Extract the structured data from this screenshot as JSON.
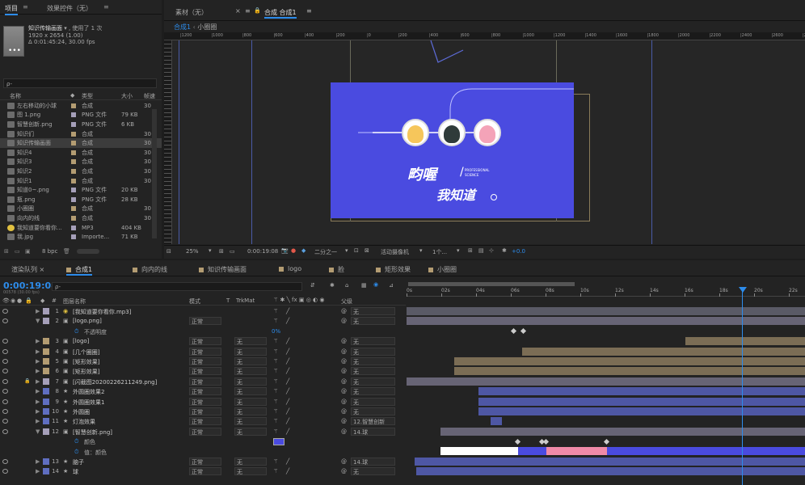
{
  "project": {
    "tab_label": "项目",
    "effects_tab": "效果控件（无）",
    "selected_name": "知识传输画面",
    "used_count": ", 使用了 1 次",
    "resolution": "1920 x 2654 (1.00)",
    "duration": "Δ 0:01:45:24, 30.00 fps",
    "search_placeholder": "ρ-",
    "columns": {
      "name": "名称",
      "type": "类型",
      "size": "大小",
      "fps": "帧速"
    },
    "items": [
      {
        "name": "左右移动的小球",
        "type": "合成",
        "size": "",
        "fps": "30",
        "color": "#b39c72"
      },
      {
        "name": "图 1.png",
        "type": "PNG 文件",
        "size": "79 KB",
        "fps": "",
        "color": "#a59fb9"
      },
      {
        "name": "智慧创新.png",
        "type": "PNG 文件",
        "size": "6 KB",
        "fps": "",
        "color": "#a59fb9"
      },
      {
        "name": "知识们",
        "type": "合成",
        "size": "",
        "fps": "30",
        "color": "#b39c72"
      },
      {
        "name": "知识传输画面",
        "type": "合成",
        "size": "",
        "fps": "30",
        "color": "#b39c72"
      },
      {
        "name": "知识4",
        "type": "合成",
        "size": "",
        "fps": "30",
        "color": "#b39c72"
      },
      {
        "name": "知识3",
        "type": "合成",
        "size": "",
        "fps": "30",
        "color": "#b39c72"
      },
      {
        "name": "知识2",
        "type": "合成",
        "size": "",
        "fps": "30",
        "color": "#b39c72"
      },
      {
        "name": "知识1",
        "type": "合成",
        "size": "",
        "fps": "30",
        "color": "#b39c72"
      },
      {
        "name": "知道0~.png",
        "type": "PNG 文件",
        "size": "20 KB",
        "fps": "",
        "color": "#a59fb9"
      },
      {
        "name": "瓶.png",
        "type": "PNG 文件",
        "size": "28 KB",
        "fps": "",
        "color": "#a59fb9"
      },
      {
        "name": "小圈圈",
        "type": "合成",
        "size": "",
        "fps": "30",
        "color": "#b39c72"
      },
      {
        "name": "向内的线",
        "type": "合成",
        "size": "",
        "fps": "30",
        "color": "#b39c72"
      },
      {
        "name": "我知道要你看你...",
        "type": "MP3",
        "size": "404 KB",
        "fps": "",
        "color": "#a59fb9"
      },
      {
        "name": "我.jpg",
        "type": "Importe...",
        "size": "71 KB",
        "fps": "",
        "color": "#a59fb9"
      }
    ],
    "bpc": "8 bpc"
  },
  "composition": {
    "footage_tab": "素材（无）",
    "comp_tab": "合成 合成1",
    "breadcrumb": [
      "合成1",
      "小圈圈"
    ],
    "ruler": [
      "|1200",
      "|1000",
      "|800",
      "|600",
      "|400",
      "|200",
      "|0",
      "|200",
      "|400",
      "|600",
      "|800",
      "|1000",
      "|1200",
      "|1400",
      "|1600",
      "|1800",
      "|2000",
      "|2200",
      "|2400",
      "|2600",
      "|2800",
      "|3000"
    ],
    "zoom": "25%",
    "timecode": "0:00:19:08",
    "resolution": "二分之一",
    "camera": "活动摄像机",
    "views": "1个...",
    "exposure": "+0.0",
    "canvas_bg": "#4a4be0",
    "logo_main": "畇喔",
    "logo_sub": "我知道",
    "logo_en": "PROFESSIONAL\nSCIENCE"
  },
  "timeline": {
    "tabs": [
      "渲染队列",
      "合成1",
      "向内的线",
      "知识传输画面",
      "logo",
      "脸",
      "矩形效果",
      "小圈圈"
    ],
    "current_time": "0:00:19:08",
    "frame_info": "00578 (30.00 fps)",
    "search_placeholder": "ρ-",
    "headers": {
      "num": "#",
      "name": "图层名称",
      "mode": "模式",
      "t": "T",
      "trkmat": "TrkMat",
      "parent": "父级"
    },
    "time_marks": [
      "0s",
      "02s",
      "04s",
      "06s",
      "08s",
      "10s",
      "12s",
      "14s",
      "16s",
      "18s",
      "20s",
      "22s"
    ],
    "layers": [
      {
        "num": "1",
        "name": "[我知道要你看你.mp3]",
        "mode": "",
        "trk": "",
        "parent": "无",
        "color": "#a59fb9",
        "type": "audio"
      },
      {
        "num": "2",
        "name": "[logo.png]",
        "mode": "正常",
        "trk": "",
        "parent": "无",
        "color": "#a59fb9",
        "type": "png",
        "expanded": true
      },
      {
        "num": "",
        "name": "不透明度",
        "prop": true,
        "value": "0%"
      },
      {
        "num": "3",
        "name": "[logo]",
        "mode": "正常",
        "trk": "无",
        "parent": "无",
        "color": "#b39c72",
        "type": "comp"
      },
      {
        "num": "4",
        "name": "[几个圈圈]",
        "mode": "正常",
        "trk": "无",
        "parent": "无",
        "color": "#b39c72",
        "type": "comp"
      },
      {
        "num": "5",
        "name": "[矩形效果]",
        "mode": "正常",
        "trk": "无",
        "parent": "无",
        "color": "#b39c72",
        "type": "comp"
      },
      {
        "num": "6",
        "name": "[矩形效果]",
        "mode": "正常",
        "trk": "无",
        "parent": "无",
        "color": "#b39c72",
        "type": "comp"
      },
      {
        "num": "7",
        "name": "[闪截图20200226211249.png]",
        "mode": "正常",
        "trk": "无",
        "parent": "无",
        "color": "#a59fb9",
        "type": "png",
        "locked": true
      },
      {
        "num": "8",
        "name": "外圆圈效果2",
        "mode": "正常",
        "trk": "无",
        "parent": "无",
        "color": "#5f6ec1",
        "type": "shape"
      },
      {
        "num": "9",
        "name": "外圆圈效果1",
        "mode": "正常",
        "trk": "无",
        "parent": "无",
        "color": "#5f6ec1",
        "type": "shape"
      },
      {
        "num": "10",
        "name": "外圆圈",
        "mode": "正常",
        "trk": "无",
        "parent": "无",
        "color": "#5f6ec1",
        "type": "shape"
      },
      {
        "num": "11",
        "name": "灯泡效果",
        "mode": "正常",
        "trk": "无",
        "parent": "12.智慧创新",
        "color": "#5f6ec1",
        "type": "shape"
      },
      {
        "num": "12",
        "name": "[智慧创新.png]",
        "mode": "正常",
        "trk": "无",
        "parent": "14.球",
        "color": "#a59fb9",
        "type": "png",
        "expanded": true
      },
      {
        "num": "",
        "name": "颜色",
        "prop": true,
        "value": ""
      },
      {
        "num": "",
        "name": "值：颜色",
        "prop": true,
        "value": ""
      },
      {
        "num": "13",
        "name": "脑子",
        "mode": "正常",
        "trk": "无",
        "parent": "14.球",
        "color": "#5f6ec1",
        "type": "shape"
      },
      {
        "num": "14",
        "name": "球",
        "mode": "正常",
        "trk": "无",
        "parent": "无",
        "color": "#5f6ec1",
        "type": "shape"
      }
    ]
  }
}
